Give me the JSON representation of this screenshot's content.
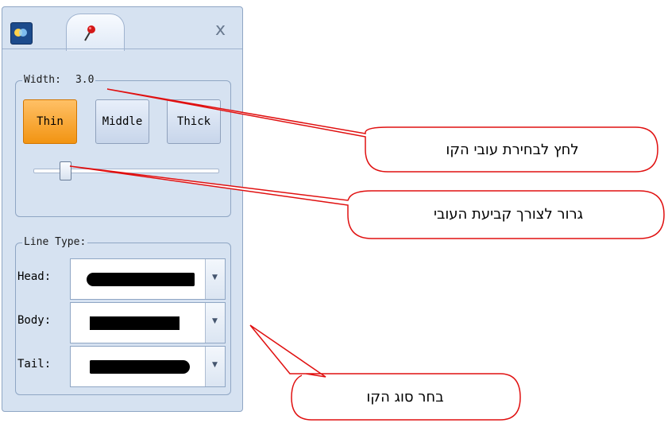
{
  "window": {
    "close_label": "x",
    "active_tab_icon": "pushpin-icon",
    "app_icon": "app-logo-icon"
  },
  "width_group": {
    "legend": "Width:",
    "value": "3.0",
    "buttons": [
      {
        "label": "Thin",
        "active": true
      },
      {
        "label": "Middle",
        "active": false
      },
      {
        "label": "Thick",
        "active": false
      }
    ],
    "slider_level": 0.15
  },
  "line_type_group": {
    "legend": "Line Type:",
    "rows": [
      {
        "label": "Head:",
        "sample": "rounded-head"
      },
      {
        "label": "Body:",
        "sample": "square"
      },
      {
        "label": "Tail:",
        "sample": "rounded-tail"
      }
    ]
  },
  "callouts": [
    {
      "text": "לחץ לבחירת עובי הקו"
    },
    {
      "text": "גרור לצורך קביעת העובי"
    },
    {
      "text": "בחר סוג הקו"
    }
  ],
  "colors": {
    "panel_bg": "#d6e2f1",
    "active_button": "#f29412",
    "callout_border": "#e01010"
  }
}
